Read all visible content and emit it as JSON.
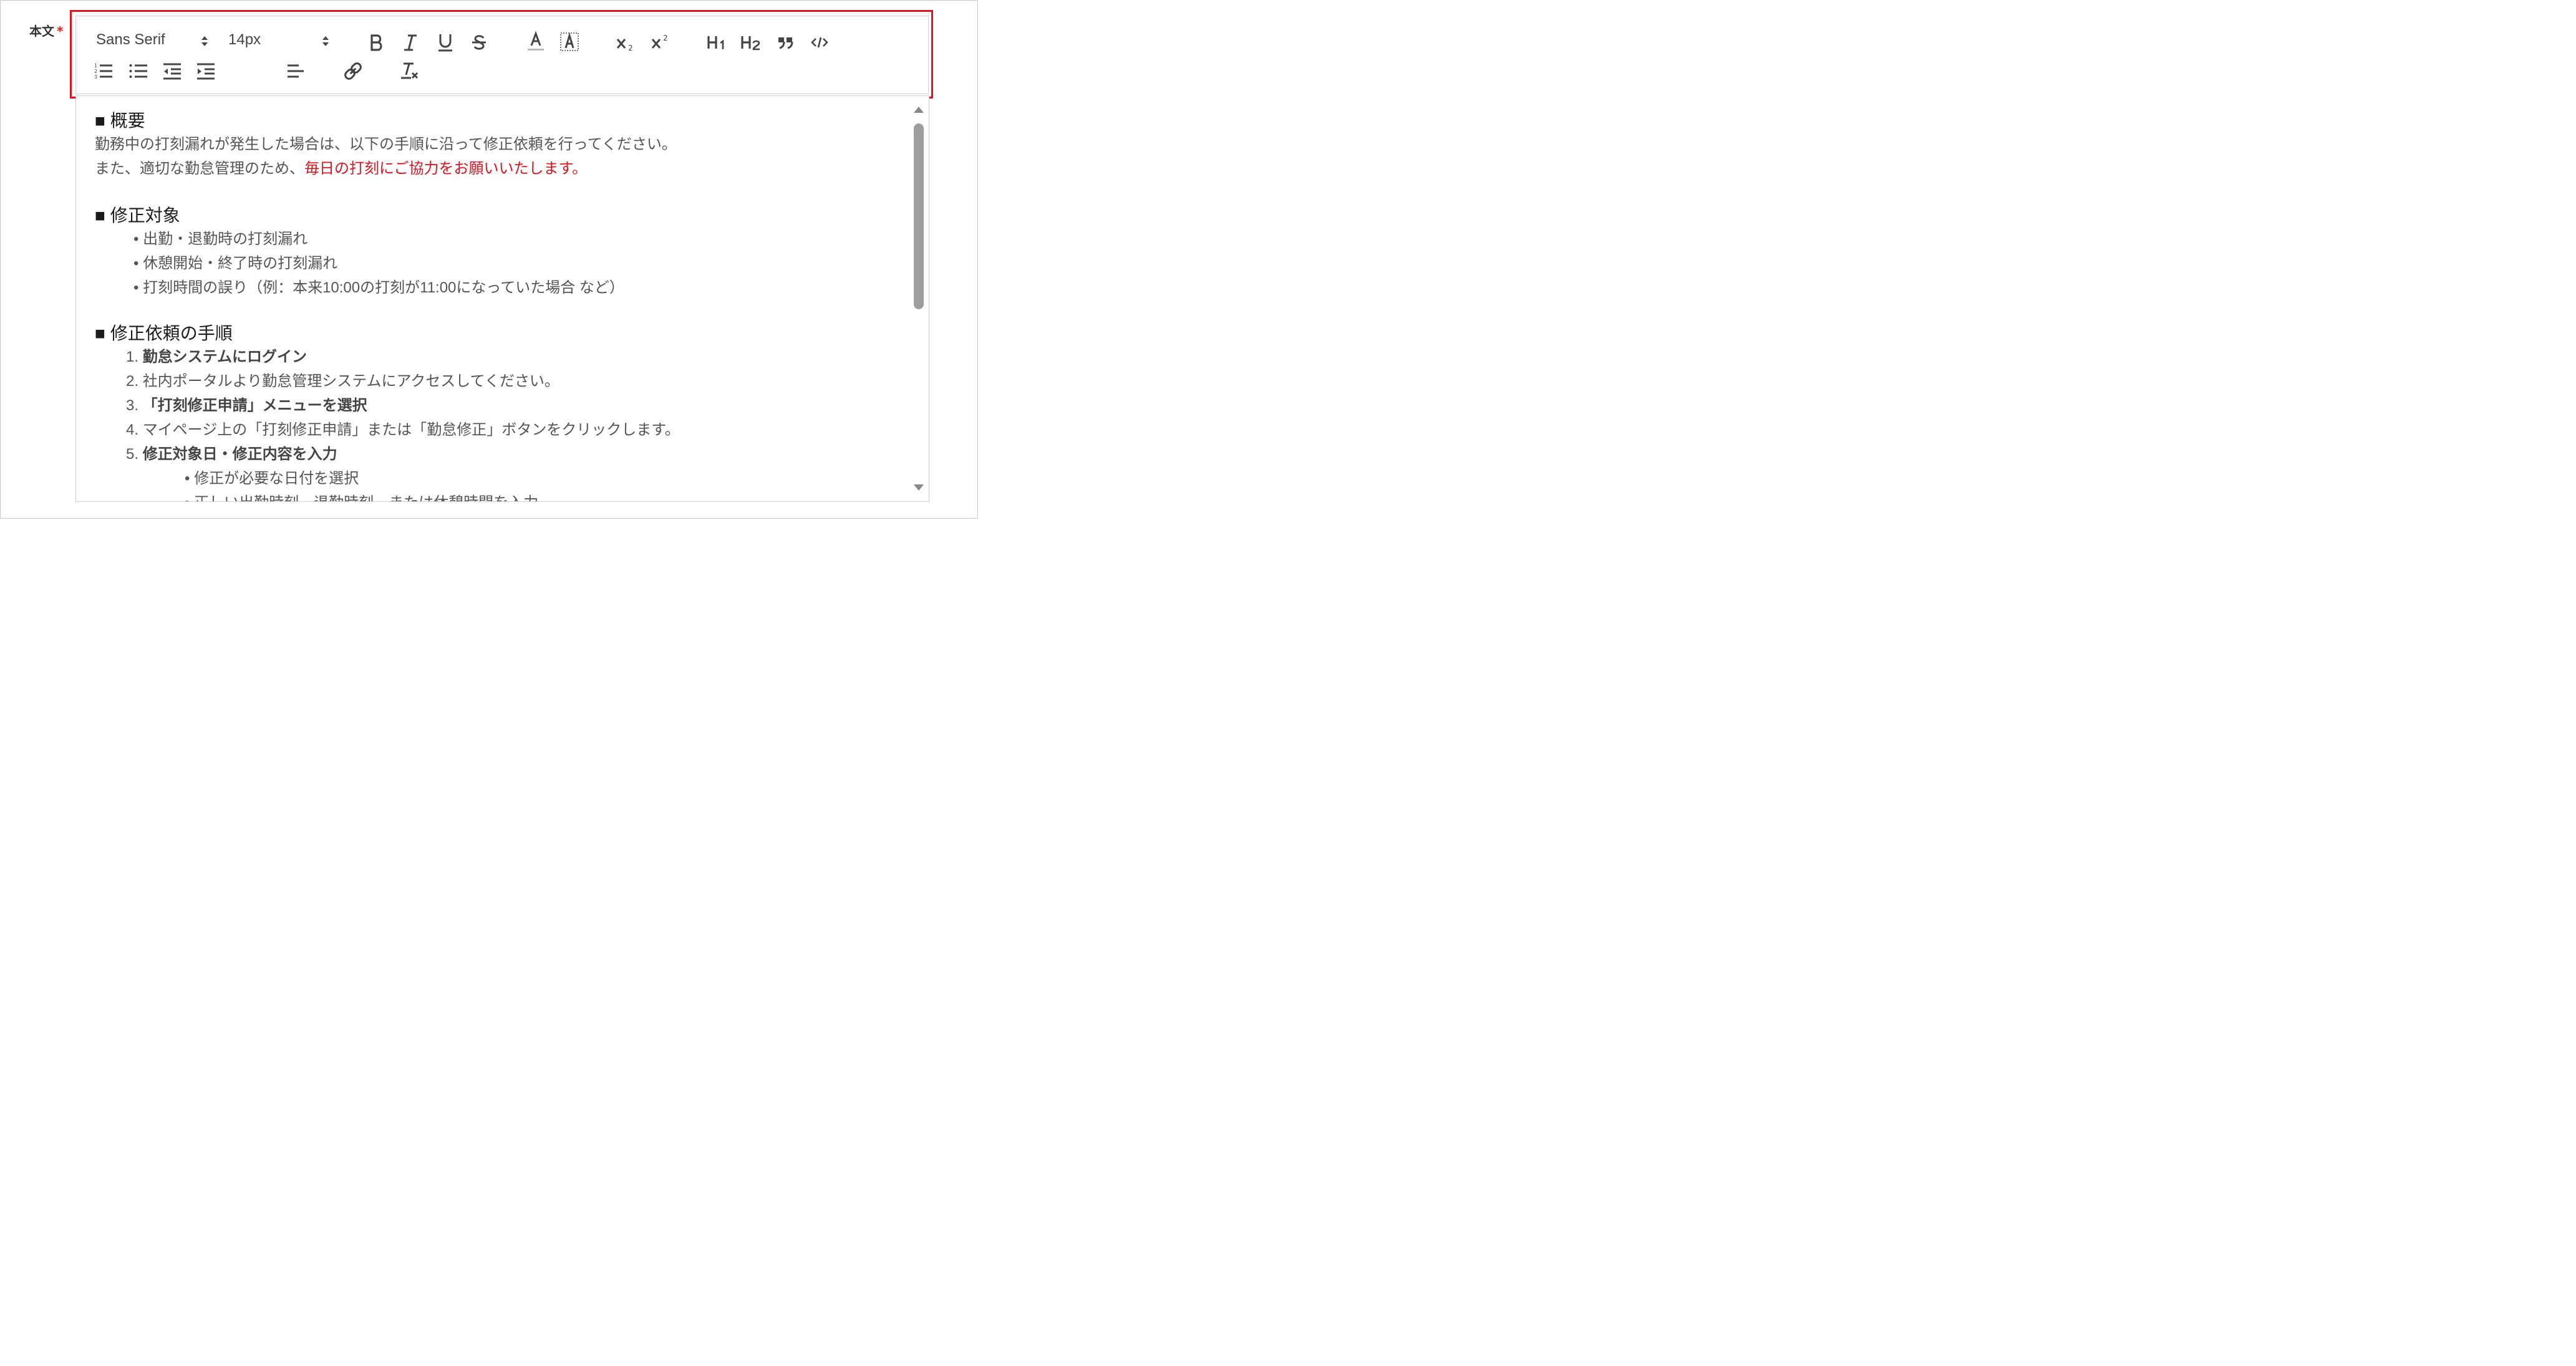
{
  "field": {
    "label": "本文",
    "required_mark": "*"
  },
  "toolbar": {
    "font_family": "Sans Serif",
    "font_size": "14px",
    "buttons": [
      "bold",
      "italic",
      "underline",
      "strikethrough",
      "text-color",
      "background-color",
      "subscript",
      "superscript",
      "header-1",
      "header-2",
      "blockquote",
      "code-block",
      "ordered-list",
      "bullet-list",
      "outdent",
      "indent",
      "align",
      "link",
      "clean"
    ]
  },
  "editor": {
    "sec1_title": "■ 概要",
    "sec1_line1": "勤務中の打刻漏れが発生した場合は、以下の手順に沿って修正依頼を行ってください。",
    "sec1_line2_plain": "また、適切な勤怠管理のため、",
    "sec1_line2_red": "毎日の打刻にご協力をお願いいたします。",
    "sec2_title": "■ 修正対象",
    "sec2_items": [
      "• 出勤・退勤時の打刻漏れ",
      "• 休憩開始・終了時の打刻漏れ",
      "• 打刻時間の誤り（例：本来10:00の打刻が11:00になっていた場合 など）"
    ],
    "sec3_title": "■ 修正依頼の手順",
    "sec3_steps": [
      {
        "num": "1.",
        "text": "勤怠システムにログイン",
        "bold": true
      },
      {
        "num": "2.",
        "text": "社内ポータルより勤怠管理システムにアクセスしてください。",
        "bold": false
      },
      {
        "num": "3.",
        "text": "「打刻修正申請」メニューを選択",
        "bold": true
      },
      {
        "num": "4.",
        "text": "マイページ上の「打刻修正申請」または「勤怠修正」ボタンをクリックします。",
        "bold": false
      },
      {
        "num": "5.",
        "text": "修正対象日・修正内容を入力",
        "bold": true
      }
    ],
    "sec3_sub": [
      "• 修正が必要な日付を選択",
      "• 正しい出勤時刻、退勤時刻、または休憩時間を入力"
    ]
  },
  "colors": {
    "highlight": "#e0141e",
    "emphasis_text": "#e0141e"
  }
}
